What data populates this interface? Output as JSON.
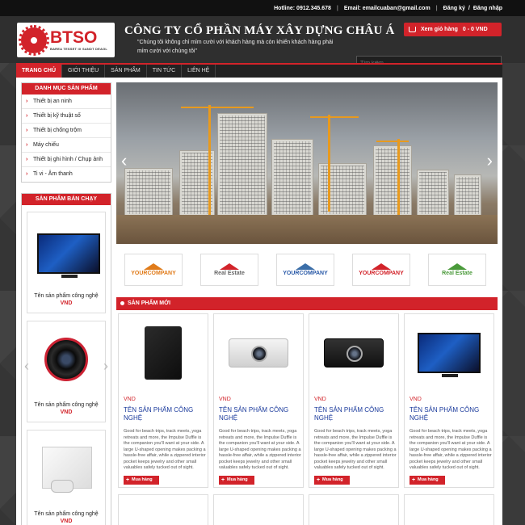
{
  "topbar": {
    "hotline_label": "Hotline: 0912.345.678",
    "email_label": "Email: emailcuaban@gmail.com",
    "register": "Đăng ký",
    "login": "Đăng nhập"
  },
  "header": {
    "logo_text": "BTSO",
    "logo_sub": "BAREA TESSET IX SANDT DEAGL",
    "company_name": "CÔNG TY CỔ PHẦN MÁY XÂY DỰNG CHÂU Á",
    "slogan": "\"Chúng tôi không chỉ mỉm cười với khách hàng mà còn khiến khách hàng phải mỉm cười với chúng tôi\"",
    "cart_label": "Xem giỏ hàng",
    "cart_summary": "0 - 0 VND",
    "search_placeholder": "Tìm kiếm"
  },
  "nav": [
    {
      "label": "TRANG CHỦ"
    },
    {
      "label": "GIỚI THIỆU"
    },
    {
      "label": "SẢN PHẨM"
    },
    {
      "label": "TIN TỨC"
    },
    {
      "label": "LIÊN HỆ"
    }
  ],
  "sidebar": {
    "category_title": "Danh mục sản phẩm",
    "categories": [
      {
        "label": "Thiết bị an ninh"
      },
      {
        "label": "Thiết bị kỹ thuật số"
      },
      {
        "label": "Thiết bị chống trộm"
      },
      {
        "label": "Máy chiếu"
      },
      {
        "label": "Thiết bị ghi hình / Chụp ảnh"
      },
      {
        "label": "Ti vi - Âm thanh"
      }
    ],
    "bestseller_title": "Sản phẩm bán chạy",
    "bestsellers": [
      {
        "name": "Tên sản phẩm công nghệ",
        "price": "VND"
      },
      {
        "name": "Tên sản phẩm công nghệ",
        "price": "VND"
      },
      {
        "name": "Tên sản phẩm công nghệ",
        "price": "VND"
      }
    ]
  },
  "partners": [
    {
      "label": "YOURCOMPANY",
      "color": "#e07b1a"
    },
    {
      "label": "Real Estate",
      "color": "#666666"
    },
    {
      "label": "YOURCOMPANY",
      "color": "#2a5aa8"
    },
    {
      "label": "YOURCOMPANY",
      "color": "#d2232a"
    },
    {
      "label": "Real Estate",
      "color": "#4a9a3a"
    }
  ],
  "new_products": {
    "title": "Sản phẩm mới",
    "items": [
      {
        "price": "VND",
        "title": "TÊN SẢN PHẨM CÔNG NGHỆ",
        "description": "Good for beach trips, track meets, yoga retreats and more, the Impulse Duffle is the companion you'll want at your side. A large U-shaped opening makes packing a hassle-free affair, while a zippered interior pocket keeps jewelry and other small valuables safely tucked out of sight.",
        "buy": "Mua hàng"
      },
      {
        "price": "VND",
        "title": "TÊN SẢN PHẨM CÔNG NGHỆ",
        "description": "Good for beach trips, track meets, yoga retreats and more, the Impulse Duffle is the companion you'll want at your side. A large U-shaped opening makes packing a hassle-free affair, while a zippered interior pocket keeps jewelry and other small valuables safely tucked out of sight.",
        "buy": "Mua hàng"
      },
      {
        "price": "VND",
        "title": "TÊN SẢN PHẨM CÔNG NGHỆ",
        "description": "Good for beach trips, track meets, yoga retreats and more, the Impulse Duffle is the companion you'll want at your side. A large U-shaped opening makes packing a hassle-free affair, while a zippered interior pocket keeps jewelry and other small valuables safely tucked out of sight.",
        "buy": "Mua hàng"
      },
      {
        "price": "VND",
        "title": "TÊN SẢN PHẨM CÔNG NGHỆ",
        "description": "Good for beach trips, track meets, yoga retreats and more, the Impulse Duffle is the companion you'll want at your side. A large U-shaped opening makes packing a hassle-free affair, while a zippered interior pocket keeps jewelry and other small valuables safely tucked out of sight.",
        "buy": "Mua hàng"
      }
    ]
  },
  "colors": {
    "accent": "#d2232a",
    "link": "#1a3a9c",
    "dark": "#2f2f2f"
  }
}
